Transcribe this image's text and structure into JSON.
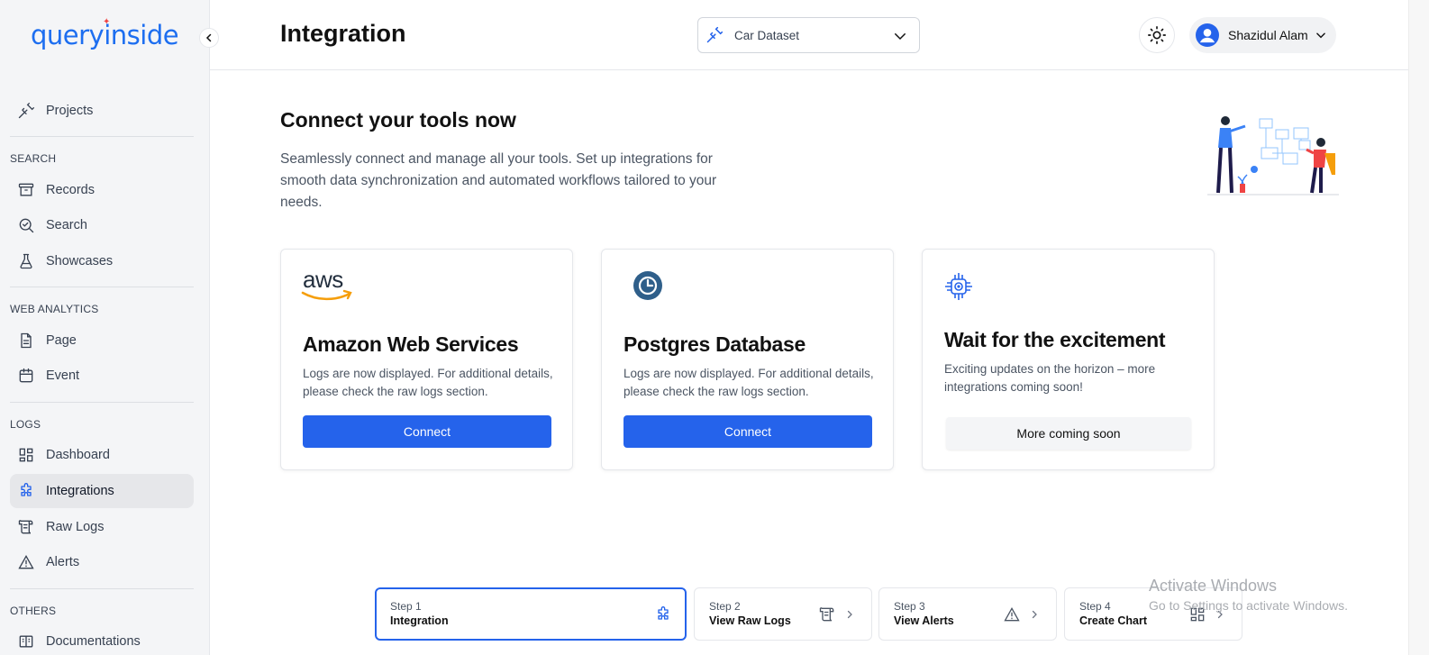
{
  "app": {
    "logo": "queryinside",
    "page_title": "Integration"
  },
  "sidebar": {
    "projects": "Projects",
    "sections": {
      "search": "SEARCH",
      "web_analytics": "WEB ANALYTICS",
      "logs": "LOGS",
      "others": "OTHERS"
    },
    "items": {
      "records": "Records",
      "search": "Search",
      "showcases": "Showcases",
      "page": "Page",
      "event": "Event",
      "dashboard": "Dashboard",
      "integrations": "Integrations",
      "raw_logs": "Raw Logs",
      "alerts": "Alerts",
      "documentations": "Documentations"
    }
  },
  "header": {
    "dataset": "Car Dataset",
    "user_name": "Shazidul Alam"
  },
  "hero": {
    "title": "Connect your tools now",
    "description": "Seamlessly connect and manage all your tools. Set up integrations for smooth data synchronization and automated workflows tailored to your needs."
  },
  "cards": [
    {
      "logo_text": "aws",
      "title": "Amazon Web Services",
      "description": "Logs are now displayed. For additional details, please check the raw logs section.",
      "button": "Connect"
    },
    {
      "title": "Postgres Database",
      "description": "Logs are now displayed. For additional details, please check the raw logs section.",
      "button": "Connect"
    },
    {
      "title": "Wait for the excitement",
      "description": "Exciting updates on the horizon – more integrations coming soon!",
      "button": "More coming soon"
    }
  ],
  "steps": [
    {
      "num": "Step 1",
      "name": "Integration"
    },
    {
      "num": "Step 2",
      "name": "View Raw Logs"
    },
    {
      "num": "Step 3",
      "name": "View Alerts"
    },
    {
      "num": "Step 4",
      "name": "Create Chart"
    }
  ],
  "watermark": {
    "line1": "Activate Windows",
    "line2": "Go to Settings to activate Windows."
  },
  "colors": {
    "accent": "#2563eb",
    "brand": "#1d6ef0",
    "postgres": "#2f5f8a"
  }
}
